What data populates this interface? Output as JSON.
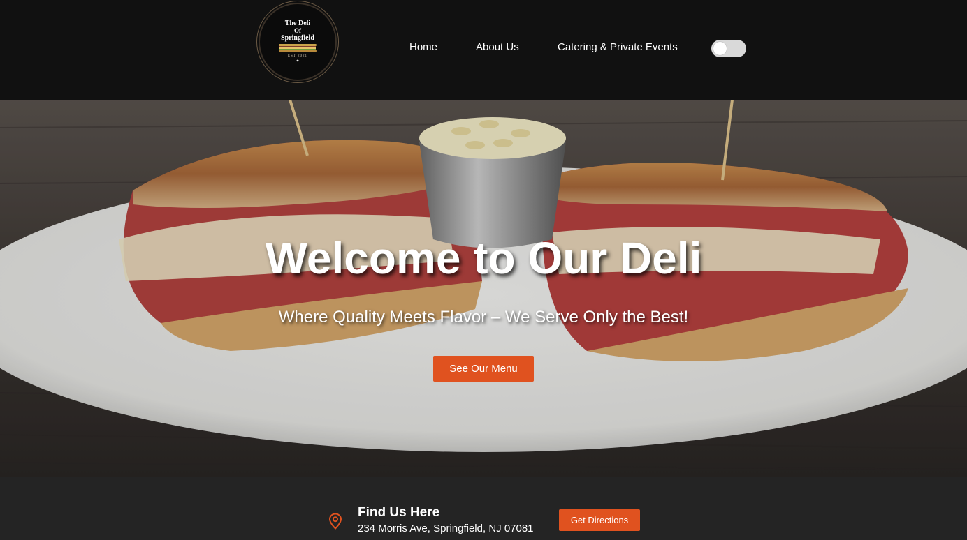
{
  "brand": {
    "logo_line1": "The Deli",
    "logo_line2": "Of",
    "logo_line3": "Springfield",
    "logo_est": "EST 2021",
    "logo_star": "✦"
  },
  "nav": {
    "items": [
      {
        "label": "Home"
      },
      {
        "label": "About Us"
      },
      {
        "label": "Catering & Private Events"
      }
    ],
    "theme_toggle": {
      "state": "off"
    }
  },
  "hero": {
    "title": "Welcome to Our Deli",
    "subtitle": "Where Quality Meets Flavor – We Serve Only the Best!",
    "cta_label": "See Our Menu"
  },
  "location": {
    "icon": "map-pin-icon",
    "title": "Find Us Here",
    "address": "234 Morris Ave, Springfield, NJ 07081",
    "directions_label": "Get Directions"
  },
  "colors": {
    "accent": "#e0521f",
    "header_bg": "#111111",
    "footer_bg": "#242424"
  }
}
